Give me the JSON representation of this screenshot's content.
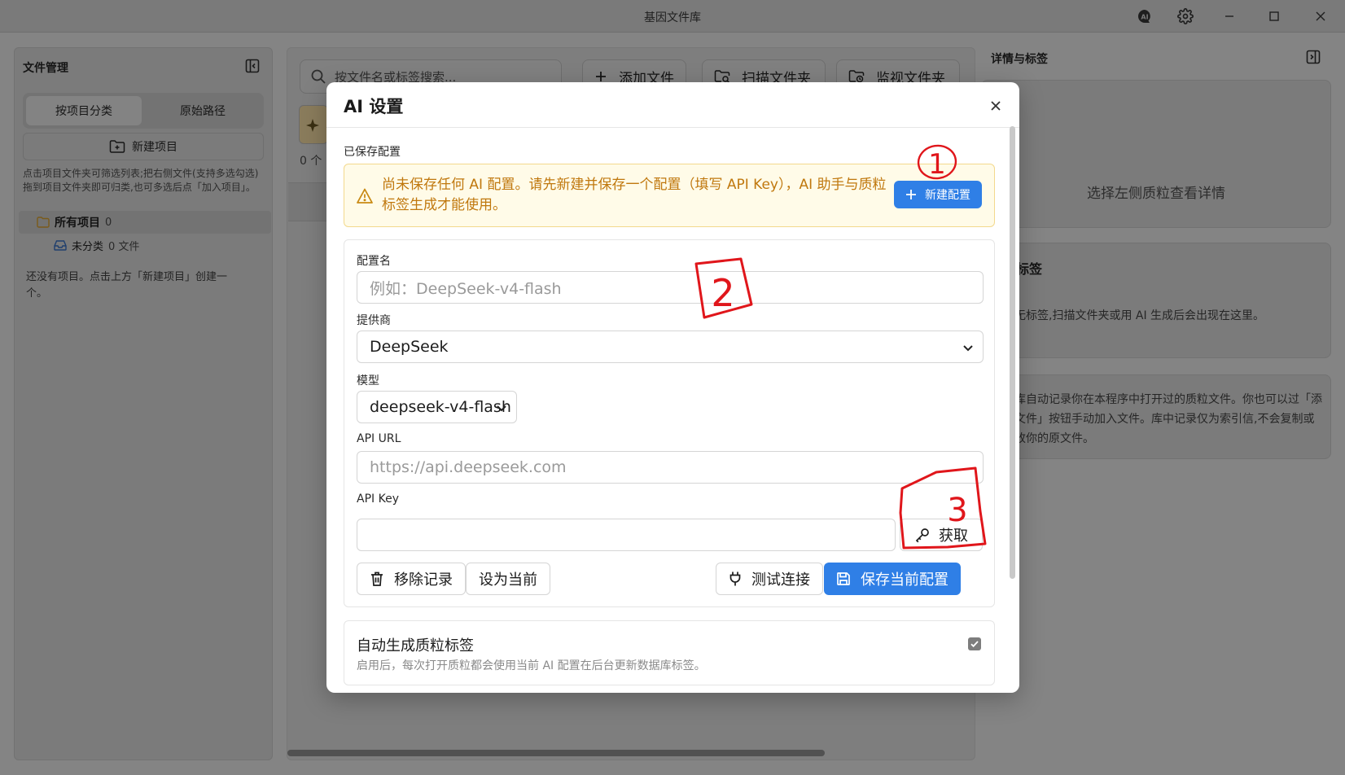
{
  "window": {
    "title": "基因文件库",
    "ai_icon_text": "AI"
  },
  "left_panel": {
    "title": "文件管理",
    "tabs": [
      {
        "label": "按项目分类",
        "active": true
      },
      {
        "label": "原始路径",
        "active": false
      }
    ],
    "new_project_label": "新建项目",
    "hint": "点击项目文件夹可筛选列表;把右侧文件(支持多选勾选)拖到项目文件夹即可归类,也可多选后点「加入项目」。",
    "tree": {
      "all": {
        "label": "所有项目",
        "count": "0"
      },
      "uncategorized": {
        "label": "未分类",
        "count": "0 文件"
      }
    },
    "empty_text": "还没有项目。点击上方「新建项目」创建一个。"
  },
  "center_panel": {
    "search_placeholder": "按文件名或标签搜索...",
    "buttons": [
      {
        "label": "添加文件"
      },
      {
        "label": "扫描文件夹"
      },
      {
        "label": "监视文件夹"
      }
    ],
    "file_count": "0 个"
  },
  "right_panel": {
    "title": "详情与标签",
    "detail_empty": "选择左侧质粒查看详情",
    "tags_heading": "有标签",
    "tags_empty": "暂无标签,扫描文件夹或用 AI 生成后会出现在这里。",
    "library_note": "文库自动记录你在本程序中打开过的质粒文件。你也可以过「添加文件」按钮手动加入文件。库中记录仅为索引信,不会复制或修改你的原文件。"
  },
  "dialog": {
    "title": "AI 设置",
    "saved_configs_label": "已保存配置",
    "warning": "尚未保存任何 AI 配置。请先新建并保存一个配置（填写 API Key），AI 助手与质粒标签生成才能使用。",
    "new_config_button": "新建配置",
    "form": {
      "name_label": "配置名",
      "name_placeholder": "例如：DeepSeek-v4-flash",
      "provider_label": "提供商",
      "provider_value": "DeepSeek",
      "model_label": "模型",
      "model_value": "deepseek-v4-flash",
      "api_url_label": "API URL",
      "api_url_placeholder": "https://api.deepseek.com",
      "api_key_label": "API Key",
      "api_key_value": "",
      "get_key_button": "获取",
      "remove_button": "移除记录",
      "set_current_button": "设为当前",
      "test_button": "测试连接",
      "save_button": "保存当前配置"
    },
    "auto_tag": {
      "title": "自动生成质粒标签",
      "description": "启用后，每次打开质粒都会使用当前 AI 配置在后台更新数据库标签。",
      "checked": true
    }
  },
  "annotations": {
    "marks": [
      "1",
      "2",
      "3"
    ],
    "color": "#e0161b"
  },
  "colors": {
    "primary": "#2f7fe6",
    "warning_text": "#c0780e",
    "warning_bg": "#fffbe8"
  }
}
